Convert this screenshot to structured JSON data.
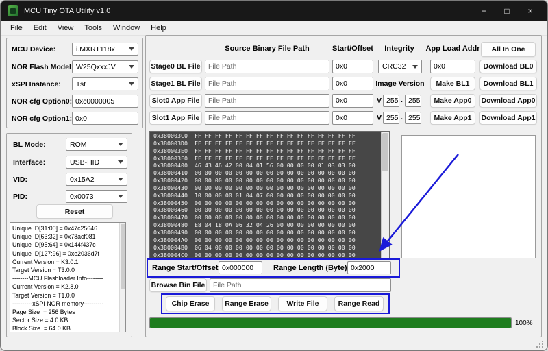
{
  "window": {
    "title": "MCU Tiny OTA Utility v1.0",
    "minimize": "−",
    "maximize": "□",
    "close": "×"
  },
  "menu": {
    "items": [
      "File",
      "Edit",
      "View",
      "Tools",
      "Window",
      "Help"
    ]
  },
  "device": {
    "mcu_label": "MCU Device:",
    "mcu_value": "i.MXRT118x",
    "flash_label": "NOR Flash Model:",
    "flash_value": "W25QxxxJV",
    "xspi_label": "xSPI Instance:",
    "xspi_value": "1st",
    "opt0_label": "NOR cfg Option0:",
    "opt0_value": "0xc0000005",
    "opt1_label": "NOR cfg Option1:",
    "opt1_value": "0x0"
  },
  "conn": {
    "bl_label": "BL Mode:",
    "bl_value": "ROM",
    "if_label": "Interface:",
    "if_value": "USB-HID",
    "vid_label": "VID:",
    "vid_value": "0x15A2",
    "pid_label": "PID:",
    "pid_value": "0x0073",
    "reset": "Reset",
    "info_lines": [
      "Unique ID[31:00] = 0x47c25646",
      "Unique ID[63:32] = 0x78acf081",
      "Unique ID[95:64] = 0x144f437c",
      "Unique ID[127:96] = 0xe2036d7f",
      "Current Version = K3.0.1",
      "Target Version = T3.0.0",
      "--------MCU Flashloader Info--------",
      "Current Version = K2.8.0",
      "Target Version = T1.0.0",
      "----------xSPI NOR memory----------",
      "Page Size  = 256 Bytes",
      "Sector Size = 4.0 KB",
      "Block Size  = 64.0 KB"
    ]
  },
  "files": {
    "headers": {
      "source": "Source Binary File Path",
      "offset": "Start/Offset",
      "integrity": "Integrity",
      "load_addr": "App Load Addr"
    },
    "all_in_one": "All In One",
    "image_version_label": "Image Version",
    "rows": [
      {
        "name": "Stage0 BL File",
        "path": "File Path",
        "offset": "0x0",
        "integrity": "CRC32",
        "load_addr": "0x0",
        "download": "Download BL0"
      },
      {
        "name": "Stage1 BL File",
        "path": "File Path",
        "offset": "0x0",
        "make": "Make BL1",
        "download": "Download BL1"
      },
      {
        "name": "Slot0 App File",
        "path": "File Path",
        "offset": "0x0",
        "v": "V",
        "major": "255",
        "dot": ".",
        "minor": "255",
        "make": "Make App0",
        "download": "Download App0"
      },
      {
        "name": "Slot1 App File",
        "path": "File Path",
        "offset": "0x0",
        "v": "V",
        "major": "255",
        "dot": ".",
        "minor": "255",
        "make": "Make App1",
        "download": "Download App1"
      }
    ]
  },
  "hex": {
    "lines": [
      "0x380003C0  FF FF FF FF FF FF FF FF FF FF FF FF FF FF FF FF",
      "0x380003D0  FF FF FF FF FF FF FF FF FF FF FF FF FF FF FF FF",
      "0x380003E0  FF FF FF FF FF FF FF FF FF FF FF FF FF FF FF FF",
      "0x380003F0  FF FF FF FF FF FF FF FF FF FF FF FF FF FF FF FF",
      "0x38000400  46 43 46 42 00 04 01 56 00 00 00 00 01 03 03 00",
      "0x38000410  00 00 00 00 00 00 00 00 00 00 00 00 00 00 00 00",
      "0x38000420  00 00 00 00 00 00 00 00 00 00 00 00 00 00 00 00",
      "0x38000430  00 00 00 00 00 00 00 00 00 00 00 00 00 00 00 00",
      "0x38000440  10 00 00 00 01 04 07 00 00 00 00 00 00 00 00 00",
      "0x38000450  00 00 00 00 00 00 00 00 00 00 00 00 00 00 00 00",
      "0x38000460  00 00 00 00 00 00 00 00 00 00 00 00 00 00 00 00",
      "0x38000470  00 00 00 00 00 00 00 00 00 00 00 00 00 00 00 00",
      "0x38000480  E8 04 18 0A 06 32 04 26 00 00 00 00 00 00 00 00",
      "0x38000490  00 00 00 00 00 00 00 00 00 00 00 00 00 00 00 00",
      "0x380004A0  00 00 00 00 00 00 00 00 00 00 00 00 00 00 00 00",
      "0x380004B0  06 04 00 00 00 00 00 00 00 00 00 00 00 00 00 00",
      "0x380004C0  00 00 00 00 00 00 00 00 00 00 00 00 00 00 00 00"
    ]
  },
  "flash": {
    "range_start_label": "Range Start/Offset:",
    "range_start_value": "0x000000",
    "range_len_label": "Range Length (Byte):",
    "range_len_value": "0x2000",
    "browse": "Browse Bin File",
    "browse_path": "File Path",
    "ops": [
      "Chip Erase",
      "Range Erase",
      "Write File",
      "Range Read"
    ],
    "progress_percent": "100%",
    "progress_value": 100
  },
  "colors": {
    "accent_blue": "#1a1ad8",
    "progress_green": "#1e7d1e",
    "titlebar_bg": "#181818",
    "hex_bg": "#474747",
    "hex_fg": "#f2f2f2"
  }
}
